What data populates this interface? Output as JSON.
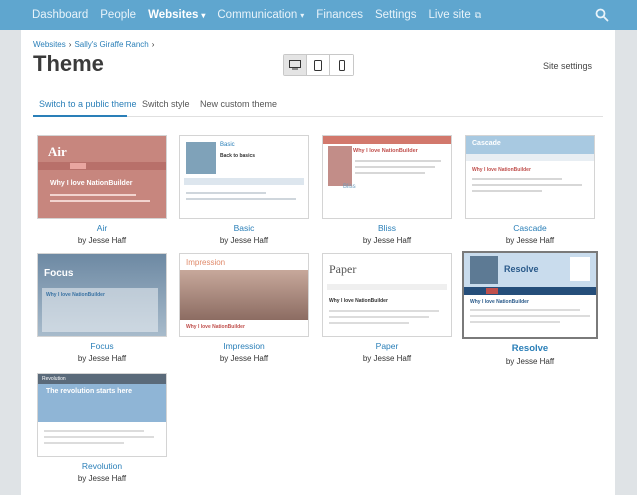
{
  "topnav": {
    "items": [
      {
        "label": "Dashboard"
      },
      {
        "label": "People"
      },
      {
        "label": "Websites",
        "caret": "▾"
      },
      {
        "label": "Communication",
        "caret": "▾"
      },
      {
        "label": "Finances"
      },
      {
        "label": "Settings"
      },
      {
        "label": "Live site",
        "ext": "⧉"
      }
    ],
    "search_icon": "search-icon"
  },
  "breadcrumb": {
    "items": [
      "Websites",
      "Sally's Giraffe Ranch"
    ],
    "separator": "›"
  },
  "page_title": "Theme",
  "devices": [
    "desktop-icon",
    "tablet-icon",
    "phone-icon"
  ],
  "site_settings": "Site settings",
  "tabs": [
    "Switch to a public theme",
    "Switch style",
    "New custom theme"
  ],
  "themes": [
    {
      "name": "Air",
      "author": "by Jesse Haff",
      "thumb_title": "Air",
      "thumb_heading": "Why I love NationBuilder"
    },
    {
      "name": "Basic",
      "author": "by Jesse Haff",
      "thumb_title": "Basic",
      "thumb_heading": "Back to basics"
    },
    {
      "name": "Bliss",
      "author": "by Jesse Haff",
      "thumb_title": "Bliss",
      "thumb_heading": "Why I love NationBuilder"
    },
    {
      "name": "Cascade",
      "author": "by Jesse Haff",
      "thumb_title": "Cascade",
      "thumb_heading": "Why I love NationBuilder"
    },
    {
      "name": "Focus",
      "author": "by Jesse Haff",
      "thumb_title": "Focus",
      "thumb_heading": "Why I love NationBuilder"
    },
    {
      "name": "Impression",
      "author": "by Jesse Haff",
      "thumb_title": "Impression",
      "thumb_heading": "Why I love NationBuilder"
    },
    {
      "name": "Paper",
      "author": "by Jesse Haff",
      "thumb_title": "Paper",
      "thumb_heading": "Why I love NationBuilder"
    },
    {
      "name": "Resolve",
      "author": "by Jesse Haff",
      "thumb_title": "Resolve",
      "thumb_heading": "Why I love NationBuilder"
    },
    {
      "name": "Revolution",
      "author": "by Jesse Haff",
      "thumb_title": "Revolution",
      "thumb_heading": "The revolution starts here"
    }
  ],
  "colors": {
    "nav": "#5fa6cf",
    "link": "#2a7fb8"
  }
}
